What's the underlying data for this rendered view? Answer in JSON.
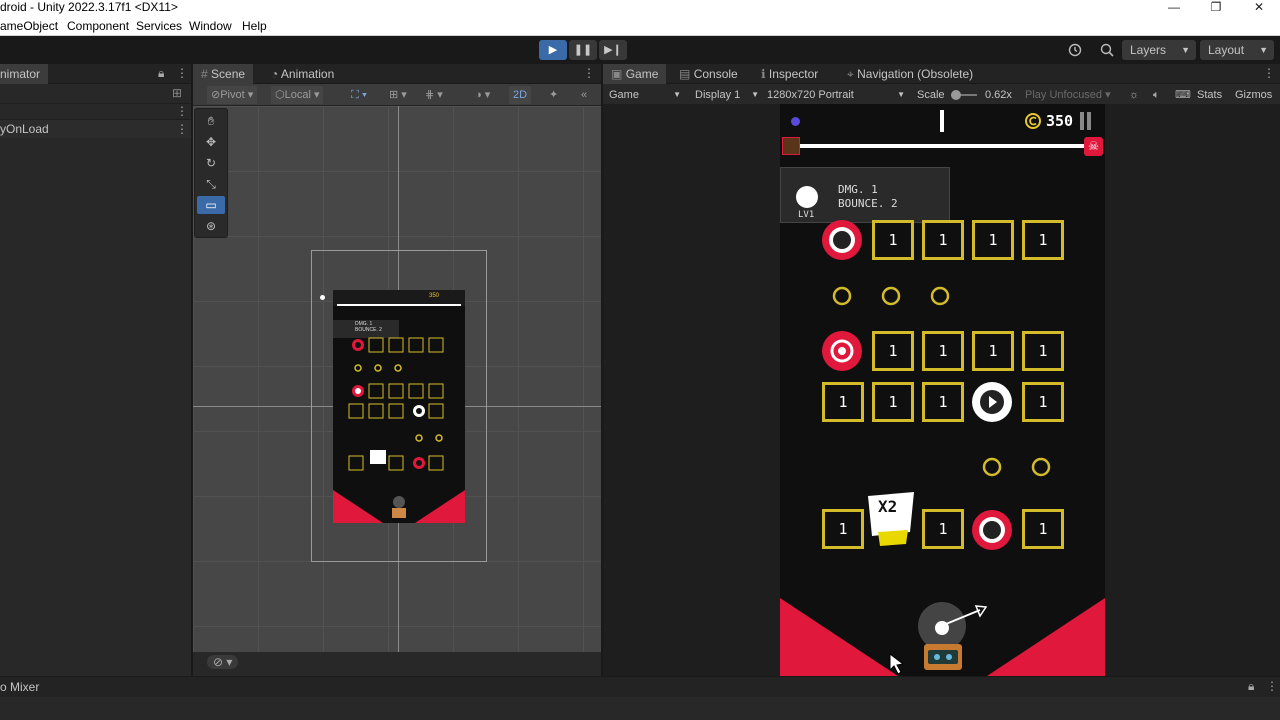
{
  "window": {
    "title": "droid - Unity 2022.3.17f1 <DX11>",
    "minimize": "—",
    "restore": "❐",
    "close": "✕"
  },
  "menu": {
    "items": [
      "ameObject",
      "Component",
      "Services",
      "Window",
      "Help"
    ]
  },
  "toolbar": {
    "play": "▶",
    "pause": "❚❚",
    "step": "▶❙",
    "layers_label": "Layers",
    "layout_label": "Layout",
    "history_icon": "history-icon",
    "search_icon": "search-icon"
  },
  "animator_panel": {
    "title": "nimator",
    "row_label": "yOnLoad"
  },
  "scene_panel": {
    "tabs": [
      "Scene",
      "Animation"
    ],
    "pivot_label": "Pivot",
    "local_label": "Local",
    "mode_2d": "2D",
    "preview": {
      "score": "350",
      "dmg": "DMG. 1",
      "bounce": "BOUNCE. 2"
    }
  },
  "game_panel": {
    "tabs": [
      "Game",
      "Console",
      "Inspector",
      "Navigation (Obsolete)"
    ],
    "mode_label": "Game",
    "display_label": "Display 1",
    "resolution_label": "1280x720 Portrait",
    "scale_label": "Scale",
    "scale_value": "0.62x",
    "play_unfocused_label": "Play Unfocused",
    "stats_label": "Stats",
    "gizmos_label": "Gizmos"
  },
  "game": {
    "score": "350",
    "dmg": "DMG. 1",
    "bounce": "BOUNCE. 2",
    "level": "LV1",
    "block_value": "1",
    "multiplier": "X2",
    "colors": {
      "accent": "#e0183c",
      "block": "#d4bb2a",
      "bg": "#0f0f0f"
    }
  },
  "bottom": {
    "audio_mixer": "o Mixer"
  }
}
